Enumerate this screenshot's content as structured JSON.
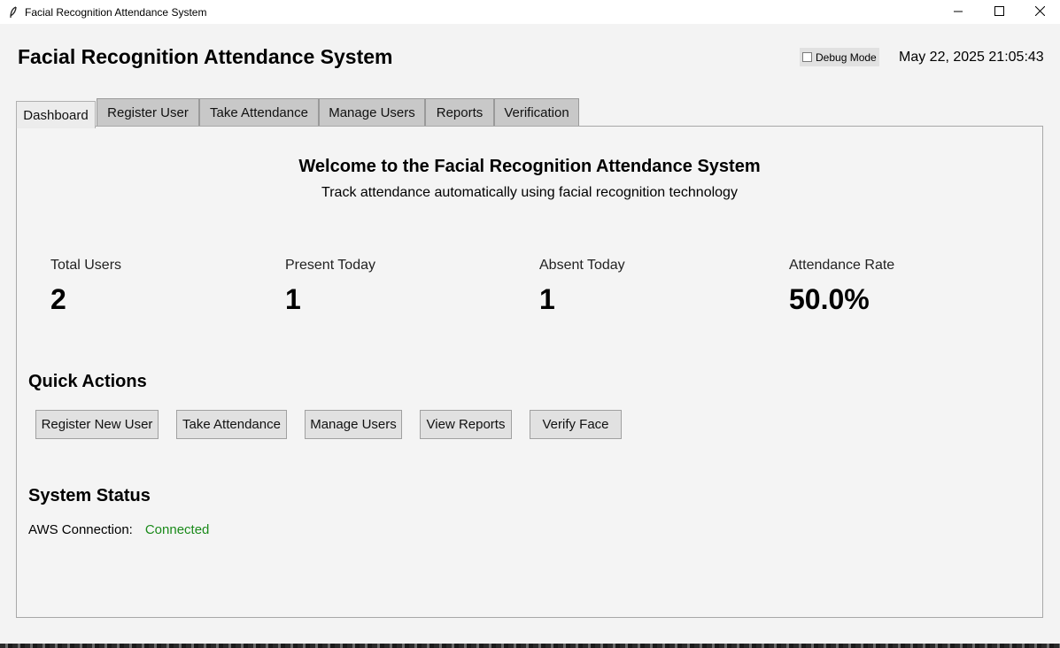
{
  "window": {
    "title": "Facial Recognition Attendance System",
    "icon": "feather-icon",
    "controls": [
      "minimize-icon",
      "maximize-icon",
      "close-icon"
    ]
  },
  "header": {
    "title": "Facial Recognition Attendance System",
    "debug_label": "Debug Mode",
    "debug_checked": false,
    "datetime": "May 22, 2025 21:05:43"
  },
  "tabs": [
    {
      "label": "Dashboard",
      "active": true
    },
    {
      "label": "Register User",
      "active": false
    },
    {
      "label": "Take Attendance",
      "active": false
    },
    {
      "label": "Manage Users",
      "active": false
    },
    {
      "label": "Reports",
      "active": false
    },
    {
      "label": "Verification",
      "active": false
    }
  ],
  "dashboard": {
    "welcome_title": "Welcome to the Facial Recognition Attendance System",
    "welcome_subtitle": "Track attendance automatically using facial recognition technology",
    "stats": [
      {
        "label": "Total Users",
        "value": "2"
      },
      {
        "label": "Present Today",
        "value": "1"
      },
      {
        "label": "Absent Today",
        "value": "1"
      },
      {
        "label": "Attendance Rate",
        "value": "50.0%"
      }
    ],
    "quick_actions_title": "Quick Actions",
    "quick_actions": [
      "Register New User",
      "Take Attendance",
      "Manage Users",
      "View Reports",
      "Verify Face"
    ],
    "system_status_title": "System Status",
    "aws_label": "AWS Connection:",
    "aws_status": "Connected"
  },
  "colors": {
    "status_connected": "#1a8a1a",
    "background": "#f3f3f3"
  }
}
